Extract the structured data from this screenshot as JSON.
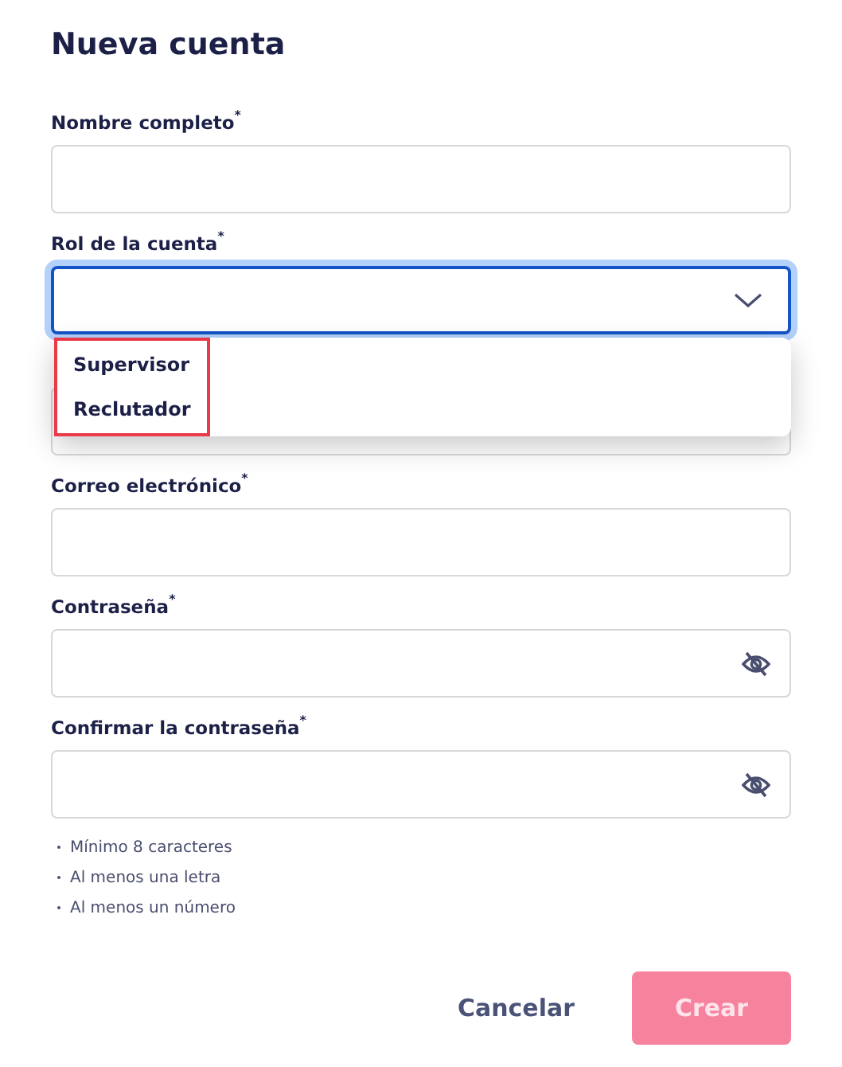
{
  "title": "Nueva cuenta",
  "fields": [
    {
      "kind": "text",
      "label": "Nombre completo$^{*}$"
    },
    {
      "kind": "select",
      "label": "Rol de la cuenta$^{*}$",
      "focused": true,
      "expanded": true,
      "options": [
        {
          "label": "Supervisor"
        },
        {
          "label": "Reclutador"
        }
      ]
    },
    {
      "kind": "text"
    },
    {
      "kind": "text",
      "label": "Correo electrónico$^{*}$"
    },
    {
      "kind": "password",
      "label": "Contraseña$^{*}$"
    },
    {
      "kind": "password",
      "label": "Confirmar la contraseña$^{*}$"
    }
  ],
  "hints": [
    "Mínimo 8 caracteres",
    "Al menos una letra",
    "Al menos un número"
  ],
  "buttons": [
    {
      "kind": "text",
      "label": "Cancelar"
    },
    {
      "kind": "primary",
      "label": "Crear",
      "disabled": true
    }
  ]
}
